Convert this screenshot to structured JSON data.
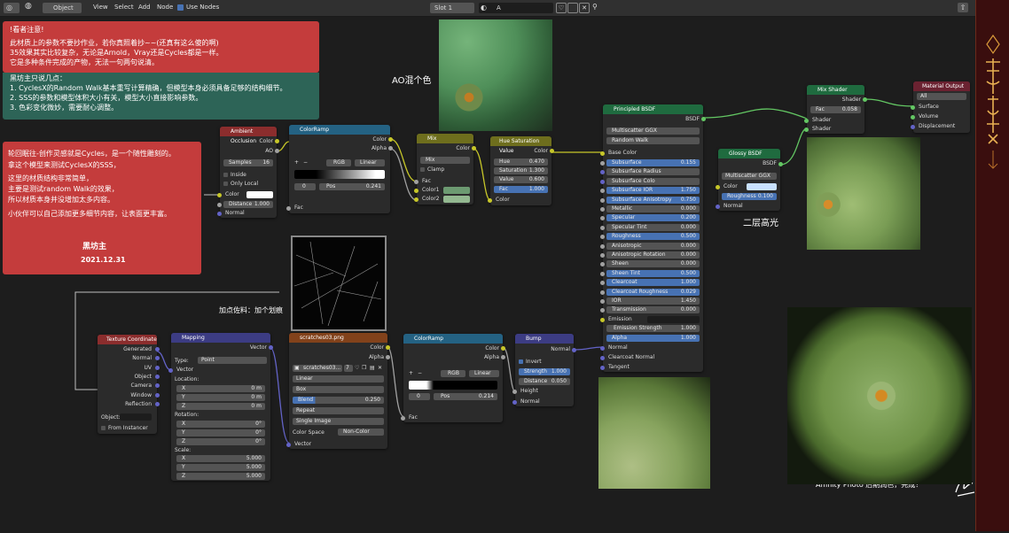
{
  "header": {
    "object_mode": "Object",
    "menus": [
      "View",
      "Select",
      "Add",
      "Node"
    ],
    "use_nodes": "Use Nodes",
    "slot": "Slot 1",
    "material": "A"
  },
  "notes": {
    "warning": {
      "title": "!看者注意!",
      "lines": [
        "此材质上的参数不要抄作业，若你真照着抄~~(还真有这么傻的啊)",
        "35效果其实比较复杂，无论是Arnold，Vray还是Cycles都是一样。",
        "它是多种条件完成的产物，无法一句两句说清。"
      ]
    },
    "points": {
      "lines": [
        "黑坊主只说几点：",
        "1. CyclesX的Random Walk基本重写计算精确，但模型本身必须具备足够的结构细节。",
        "2. SSS的参数和模型体积大小有关，模型大小直接影响参数。",
        "3. 色彩变化微妙，需要耐心调整。"
      ]
    },
    "author": {
      "lines": [
        "轮回眠往-创作灵感就是Cycles，是一个随性雕刻的。",
        "拿这个模型来测试CyclesX的SSS，",
        "这里的材质结构非常简单，",
        "主要是测试random Walk的效果，",
        "所以材质本身并没增加太多内容。",
        "小伙伴可以自己添加更多细节内容，让表面更丰富。"
      ],
      "name": "黑坊主",
      "date": "2021.12.31"
    }
  },
  "labels": {
    "ao_mix": "AO混个色",
    "second_spec": "二层高光",
    "scratch": "加点佐料：加个划痕",
    "final": "Affinity Photo 后期润色，完成！"
  },
  "nodes": {
    "ao": {
      "title": "Ambient Occlusion",
      "out1": "Color",
      "out2": "AO",
      "samples_label": "Samples",
      "samples": "16",
      "inside": "Inside",
      "only_local": "Only Local",
      "color": "Color",
      "distance_label": "Distance",
      "distance": "1.000",
      "normal": "Normal"
    },
    "ramp1": {
      "title": "ColorRamp",
      "out1": "Color",
      "out2": "Alpha",
      "mode": "RGB",
      "interp": "Linear",
      "index": "0",
      "pos_label": "Pos",
      "pos": "0.241",
      "fac": "Fac",
      "plus": "+",
      "minus": "−"
    },
    "mix": {
      "title": "Mix",
      "out": "Color",
      "blend": "Mix",
      "clamp": "Clamp",
      "fac": "Fac",
      "c1": "Color1",
      "c2": "Color2"
    },
    "hsv": {
      "title": "Hue Saturation Value",
      "out": "Color",
      "hue_label": "Hue",
      "hue": "0.470",
      "sat_label": "Saturation",
      "sat": "1.300",
      "val_label": "Value",
      "val": "0.600",
      "fac_label": "Fac",
      "fac": "1.000",
      "color": "Color"
    },
    "bsdf": {
      "title": "Principled BSDF",
      "out": "BSDF",
      "dist": "Multiscatter GGX",
      "sss": "Random Walk",
      "base_color": "Base Color",
      "rows": [
        {
          "label": "Subsurface",
          "value": "0.155",
          "blue": true
        },
        {
          "label": "Subsurface Radius",
          "value": "",
          "blue": false
        },
        {
          "label": "Subsurface Colo",
          "value": "",
          "blue": false
        },
        {
          "label": "Subsurface IOR",
          "value": "1.750",
          "blue": true
        },
        {
          "label": "Subsurface Anisotropy",
          "value": "0.750",
          "blue": true
        },
        {
          "label": "Metallic",
          "value": "0.000",
          "blue": false
        },
        {
          "label": "Specular",
          "value": "0.200",
          "blue": true
        },
        {
          "label": "Specular Tint",
          "value": "0.000",
          "blue": false
        },
        {
          "label": "Roughness",
          "value": "0.500",
          "blue": true
        },
        {
          "label": "Anisotropic",
          "value": "0.000",
          "blue": false
        },
        {
          "label": "Anisotropic Rotation",
          "value": "0.000",
          "blue": false
        },
        {
          "label": "Sheen",
          "value": "0.000",
          "blue": false
        },
        {
          "label": "Sheen Tint",
          "value": "0.500",
          "blue": true
        },
        {
          "label": "Clearcoat",
          "value": "1.000",
          "blue": true
        },
        {
          "label": "Clearcoat Roughness",
          "value": "0.029",
          "blue": true
        },
        {
          "label": "IOR",
          "value": "1.450",
          "blue": false
        },
        {
          "label": "Transmission",
          "value": "0.000",
          "blue": false
        }
      ],
      "emission": "Emission",
      "emission_strength_label": "Emission Strength",
      "emission_strength": "1.000",
      "alpha_label": "Alpha",
      "alpha": "1.000",
      "normal": "Normal",
      "clearcoat_normal": "Clearcoat Normal",
      "tangent": "Tangent"
    },
    "glossy": {
      "title": "Glossy BSDF",
      "out": "BSDF",
      "dist": "Multiscatter GGX",
      "color": "Color",
      "rough_label": "Roughness",
      "rough": "0.100",
      "normal": "Normal"
    },
    "mixshader": {
      "title": "Mix Shader",
      "out": "Shader",
      "fac_label": "Fac",
      "fac": "0.058",
      "s1": "Shader",
      "s2": "Shader"
    },
    "output": {
      "title": "Material Output",
      "target": "All",
      "surface": "Surface",
      "volume": "Volume",
      "displacement": "Displacement"
    },
    "texcoord": {
      "title": "Texture Coordinate",
      "outputs": [
        "Generated",
        "Normal",
        "UV",
        "Object",
        "Camera",
        "Window",
        "Reflection"
      ],
      "object_label": "Object:",
      "from_instancer": "From Instancer"
    },
    "mapping": {
      "title": "Mapping",
      "out": "Vector",
      "type_label": "Type:",
      "type": "Point",
      "vector": "Vector",
      "location": "Location:",
      "loc": [
        "0 m",
        "0 m",
        "0 m"
      ],
      "rotation": "Rotation:",
      "rot": [
        "0°",
        "0°",
        "0°"
      ],
      "scale": "Scale:",
      "scl": [
        "5.000",
        "5.000",
        "5.000"
      ],
      "axes": [
        "X",
        "Y",
        "Z"
      ]
    },
    "image": {
      "title": "scratches03.png",
      "out1": "Color",
      "out2": "Alpha",
      "file": "scratches03...",
      "users": "7",
      "interp": "Linear",
      "proj": "Box",
      "blend_label": "Blend",
      "blend": "0.250",
      "ext": "Repeat",
      "source": "Single Image",
      "cs_label": "Color Space",
      "cs": "Non-Color",
      "vector": "Vector"
    },
    "ramp2": {
      "title": "ColorRamp",
      "out1": "Color",
      "out2": "Alpha",
      "mode": "RGB",
      "interp": "Linear",
      "index": "0",
      "pos_label": "Pos",
      "pos": "0.214",
      "fac": "Fac",
      "plus": "+",
      "minus": "−"
    },
    "bump": {
      "title": "Bump",
      "out": "Normal",
      "invert": "Invert",
      "strength_label": "Strength",
      "strength": "1.000",
      "dist_label": "Distance",
      "dist": "0.050",
      "height": "Height",
      "normal": "Normal"
    }
  },
  "colors": {
    "header_input": "#8b2d2d",
    "header_converter": "#246283",
    "header_color": "#6e6e1d",
    "header_shader": "#1f6b3f",
    "header_output": "#6b2231",
    "header_texture": "#82421b",
    "header_vector": "#3c3c83",
    "socket_color": "#c7c729",
    "socket_float": "#a1a1a1",
    "socket_vector": "#6363c7",
    "socket_shader": "#63c763",
    "selected": "#4772b3"
  }
}
